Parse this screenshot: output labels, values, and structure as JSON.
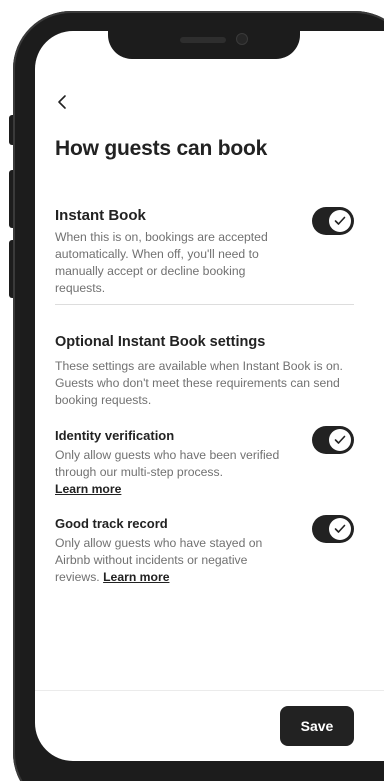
{
  "header": {
    "back_icon": "chevron-left-icon",
    "title": "How guests can book"
  },
  "instant_book": {
    "title": "Instant Book",
    "description": "When this is on, bookings are accepted automatically. When off, you'll need to manually accept or decline booking requests.",
    "enabled": true
  },
  "optional_settings": {
    "title": "Optional Instant Book settings",
    "description": "These settings are available when Instant Book is on. Guests who don't meet these requirements can send booking requests."
  },
  "identity_verification": {
    "title": "Identity verification",
    "description": "Only allow guests who have been verified through our multi-step process.",
    "link": "Learn more",
    "enabled": true
  },
  "track_record": {
    "title": "Good track record",
    "description": "Only allow guests who have stayed on Airbnb without incidents or negative reviews.",
    "link": "Learn more",
    "enabled": true
  },
  "footer": {
    "save_label": "Save"
  },
  "colors": {
    "primary_text": "#222222",
    "secondary_text": "#717171",
    "toggle_on": "#222222",
    "button_bg": "#222222",
    "divider": "#dddddd"
  }
}
